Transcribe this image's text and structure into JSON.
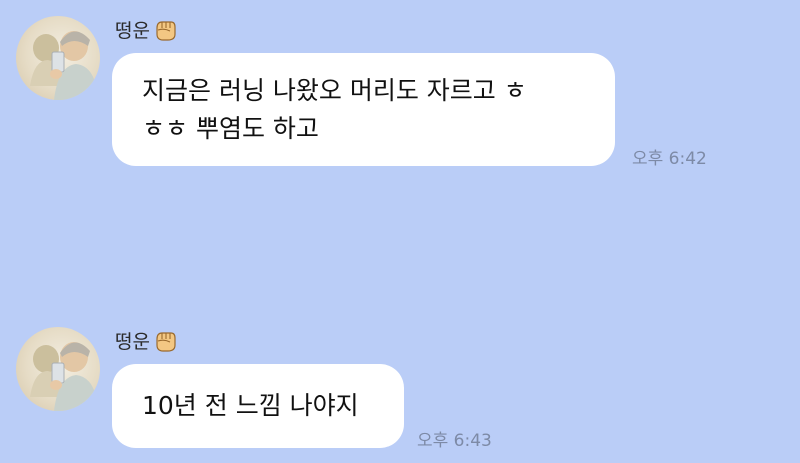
{
  "messages": [
    {
      "sender": "떵운",
      "sender_emoji": "fist-icon",
      "text_lines": [
        "지금은 러닝 나왔오 머리도 자르고 ㅎ",
        "ㅎㅎ 뿌염도 하고"
      ],
      "time": "오후 6:42"
    },
    {
      "sender": "떵운",
      "sender_emoji": "fist-icon",
      "text_lines": [
        "10년 전 느낌 나야지"
      ],
      "time": "오후 6:43"
    }
  ],
  "colors": {
    "background": "#bacdf7",
    "bubble": "#ffffff",
    "time_text": "#7d8aa6"
  }
}
